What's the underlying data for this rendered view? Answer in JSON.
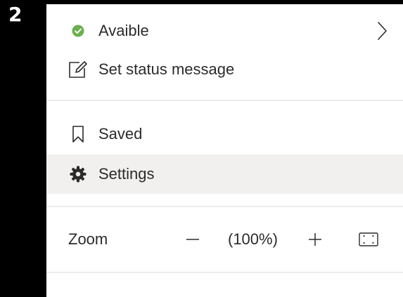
{
  "step_badge": "2",
  "menu": {
    "status": {
      "label": "Avaible",
      "status_color": "#6ab04c",
      "icon": "check-circle-icon",
      "chevron_icon": "chevron-right-icon"
    },
    "set_status": {
      "label": "Set status message",
      "icon": "edit-message-icon"
    },
    "saved": {
      "label": "Saved",
      "icon": "bookmark-icon"
    },
    "settings": {
      "label": "Settings",
      "icon": "gear-icon",
      "highlighted": true
    },
    "zoom": {
      "label": "Zoom",
      "value": "(100%)",
      "minus_icon": "minus-icon",
      "plus_icon": "plus-icon",
      "fullscreen_icon": "fullscreen-icon"
    }
  }
}
